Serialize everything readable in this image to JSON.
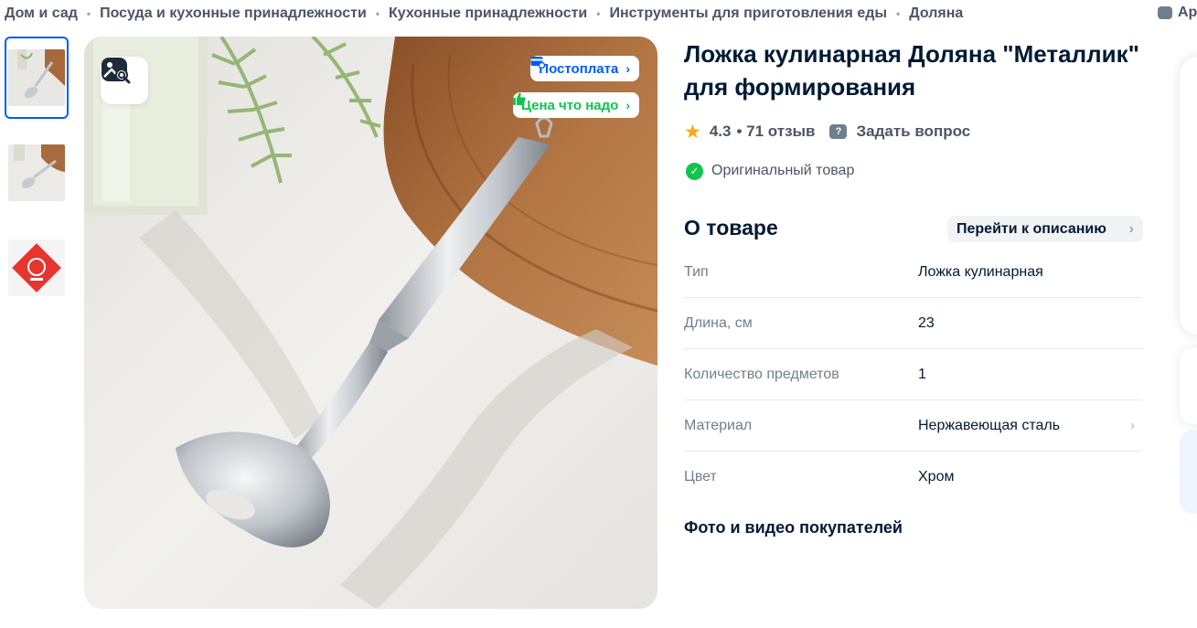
{
  "breadcrumbs": [
    "Дом и сад",
    "Посуда и кухонные принадлежности",
    "Кухонные принадлежности",
    "Инструменты для приготовления еды",
    "Доляна"
  ],
  "top_right": {
    "icon": "chat-icon",
    "label_partial": "Ар"
  },
  "thumbnails": [
    {
      "name": "thumbnail-1",
      "active": true
    },
    {
      "name": "thumbnail-2",
      "active": false
    },
    {
      "name": "thumbnail-3",
      "active": false
    }
  ],
  "badges": {
    "postpay": "Постоплата",
    "good_price": "Цена что надо"
  },
  "product": {
    "title": "Ложка кулинарная Доляна \"Металлик\" для формирования",
    "rating": "4.3",
    "reviews": "• 71 отзыв",
    "ask_question": "Задать вопрос",
    "original": "Оригинальный товар"
  },
  "about": {
    "heading": "О товаре",
    "goto_description": "Перейти к описанию",
    "specs": [
      {
        "key": "Тип",
        "value": "Ложка кулинарная",
        "link": false
      },
      {
        "key": "Длина, см",
        "value": "23",
        "link": false
      },
      {
        "key": "Количество предметов",
        "value": "1",
        "link": false
      },
      {
        "key": "Материал",
        "value": "Нержавеющая сталь",
        "link": true
      },
      {
        "key": "Цвет",
        "value": "Хром",
        "link": false
      }
    ]
  },
  "photos_heading": "Фото и видео покупателей",
  "colors": {
    "accent_blue": "#005bff",
    "accent_green": "#10c44c",
    "star": "#ffa800"
  }
}
